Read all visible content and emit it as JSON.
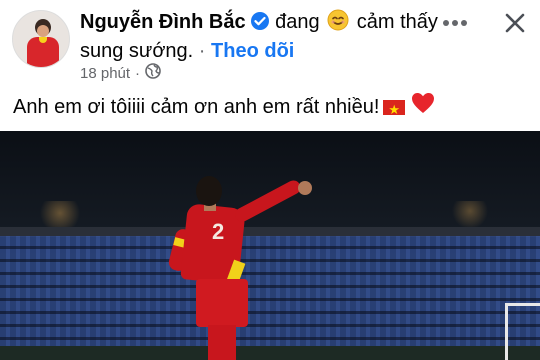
{
  "post": {
    "author": "Nguyễn Đình Bắc",
    "feeling_prefix": "đang",
    "feeling_text": "cảm thấy sung sướng.",
    "separator": "·",
    "follow_label": "Theo dõi",
    "timestamp": "18 phút",
    "meta_dot": "·",
    "privacy_icon": "globe-icon",
    "body_text": "Anh em ơi tôiiii cảm ơn anh em rất nhiều!",
    "player_number": "2"
  },
  "icons": {
    "verified": "verified-badge-icon",
    "smile": "smiling-face-icon",
    "more": "more-options-icon",
    "close": "close-icon",
    "flag": "vietnam-flag-icon",
    "heart": "red-heart-icon"
  },
  "colors": {
    "accent": "#1877f2",
    "secondary_text": "#65676b",
    "jersey_red": "#c8161d",
    "jersey_yellow": "#f1d11a",
    "heart_red": "#e7252c"
  }
}
